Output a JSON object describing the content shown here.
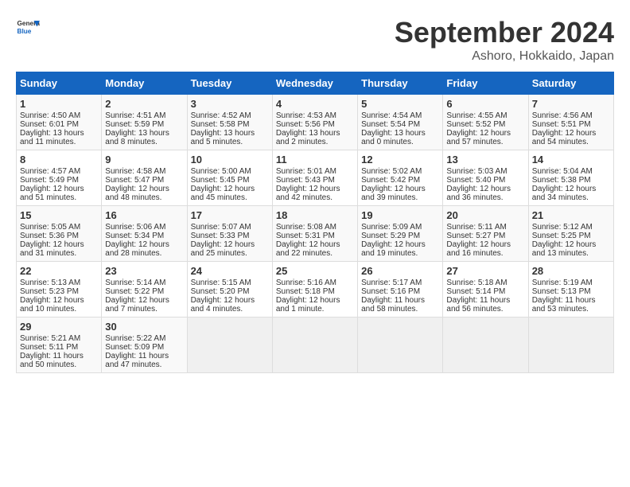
{
  "header": {
    "logo_line1": "General",
    "logo_line2": "Blue",
    "month": "September 2024",
    "location": "Ashoro, Hokkaido, Japan"
  },
  "days_of_week": [
    "Sunday",
    "Monday",
    "Tuesday",
    "Wednesday",
    "Thursday",
    "Friday",
    "Saturday"
  ],
  "weeks": [
    [
      {
        "day": "1",
        "info": [
          "Sunrise: 4:50 AM",
          "Sunset: 6:01 PM",
          "Daylight: 13 hours",
          "and 11 minutes."
        ]
      },
      {
        "day": "2",
        "info": [
          "Sunrise: 4:51 AM",
          "Sunset: 5:59 PM",
          "Daylight: 13 hours",
          "and 8 minutes."
        ]
      },
      {
        "day": "3",
        "info": [
          "Sunrise: 4:52 AM",
          "Sunset: 5:58 PM",
          "Daylight: 13 hours",
          "and 5 minutes."
        ]
      },
      {
        "day": "4",
        "info": [
          "Sunrise: 4:53 AM",
          "Sunset: 5:56 PM",
          "Daylight: 13 hours",
          "and 2 minutes."
        ]
      },
      {
        "day": "5",
        "info": [
          "Sunrise: 4:54 AM",
          "Sunset: 5:54 PM",
          "Daylight: 13 hours",
          "and 0 minutes."
        ]
      },
      {
        "day": "6",
        "info": [
          "Sunrise: 4:55 AM",
          "Sunset: 5:52 PM",
          "Daylight: 12 hours",
          "and 57 minutes."
        ]
      },
      {
        "day": "7",
        "info": [
          "Sunrise: 4:56 AM",
          "Sunset: 5:51 PM",
          "Daylight: 12 hours",
          "and 54 minutes."
        ]
      }
    ],
    [
      {
        "day": "8",
        "info": [
          "Sunrise: 4:57 AM",
          "Sunset: 5:49 PM",
          "Daylight: 12 hours",
          "and 51 minutes."
        ]
      },
      {
        "day": "9",
        "info": [
          "Sunrise: 4:58 AM",
          "Sunset: 5:47 PM",
          "Daylight: 12 hours",
          "and 48 minutes."
        ]
      },
      {
        "day": "10",
        "info": [
          "Sunrise: 5:00 AM",
          "Sunset: 5:45 PM",
          "Daylight: 12 hours",
          "and 45 minutes."
        ]
      },
      {
        "day": "11",
        "info": [
          "Sunrise: 5:01 AM",
          "Sunset: 5:43 PM",
          "Daylight: 12 hours",
          "and 42 minutes."
        ]
      },
      {
        "day": "12",
        "info": [
          "Sunrise: 5:02 AM",
          "Sunset: 5:42 PM",
          "Daylight: 12 hours",
          "and 39 minutes."
        ]
      },
      {
        "day": "13",
        "info": [
          "Sunrise: 5:03 AM",
          "Sunset: 5:40 PM",
          "Daylight: 12 hours",
          "and 36 minutes."
        ]
      },
      {
        "day": "14",
        "info": [
          "Sunrise: 5:04 AM",
          "Sunset: 5:38 PM",
          "Daylight: 12 hours",
          "and 34 minutes."
        ]
      }
    ],
    [
      {
        "day": "15",
        "info": [
          "Sunrise: 5:05 AM",
          "Sunset: 5:36 PM",
          "Daylight: 12 hours",
          "and 31 minutes."
        ]
      },
      {
        "day": "16",
        "info": [
          "Sunrise: 5:06 AM",
          "Sunset: 5:34 PM",
          "Daylight: 12 hours",
          "and 28 minutes."
        ]
      },
      {
        "day": "17",
        "info": [
          "Sunrise: 5:07 AM",
          "Sunset: 5:33 PM",
          "Daylight: 12 hours",
          "and 25 minutes."
        ]
      },
      {
        "day": "18",
        "info": [
          "Sunrise: 5:08 AM",
          "Sunset: 5:31 PM",
          "Daylight: 12 hours",
          "and 22 minutes."
        ]
      },
      {
        "day": "19",
        "info": [
          "Sunrise: 5:09 AM",
          "Sunset: 5:29 PM",
          "Daylight: 12 hours",
          "and 19 minutes."
        ]
      },
      {
        "day": "20",
        "info": [
          "Sunrise: 5:11 AM",
          "Sunset: 5:27 PM",
          "Daylight: 12 hours",
          "and 16 minutes."
        ]
      },
      {
        "day": "21",
        "info": [
          "Sunrise: 5:12 AM",
          "Sunset: 5:25 PM",
          "Daylight: 12 hours",
          "and 13 minutes."
        ]
      }
    ],
    [
      {
        "day": "22",
        "info": [
          "Sunrise: 5:13 AM",
          "Sunset: 5:23 PM",
          "Daylight: 12 hours",
          "and 10 minutes."
        ]
      },
      {
        "day": "23",
        "info": [
          "Sunrise: 5:14 AM",
          "Sunset: 5:22 PM",
          "Daylight: 12 hours",
          "and 7 minutes."
        ]
      },
      {
        "day": "24",
        "info": [
          "Sunrise: 5:15 AM",
          "Sunset: 5:20 PM",
          "Daylight: 12 hours",
          "and 4 minutes."
        ]
      },
      {
        "day": "25",
        "info": [
          "Sunrise: 5:16 AM",
          "Sunset: 5:18 PM",
          "Daylight: 12 hours",
          "and 1 minute."
        ]
      },
      {
        "day": "26",
        "info": [
          "Sunrise: 5:17 AM",
          "Sunset: 5:16 PM",
          "Daylight: 11 hours",
          "and 58 minutes."
        ]
      },
      {
        "day": "27",
        "info": [
          "Sunrise: 5:18 AM",
          "Sunset: 5:14 PM",
          "Daylight: 11 hours",
          "and 56 minutes."
        ]
      },
      {
        "day": "28",
        "info": [
          "Sunrise: 5:19 AM",
          "Sunset: 5:13 PM",
          "Daylight: 11 hours",
          "and 53 minutes."
        ]
      }
    ],
    [
      {
        "day": "29",
        "info": [
          "Sunrise: 5:21 AM",
          "Sunset: 5:11 PM",
          "Daylight: 11 hours",
          "and 50 minutes."
        ]
      },
      {
        "day": "30",
        "info": [
          "Sunrise: 5:22 AM",
          "Sunset: 5:09 PM",
          "Daylight: 11 hours",
          "and 47 minutes."
        ]
      },
      {
        "day": "",
        "info": []
      },
      {
        "day": "",
        "info": []
      },
      {
        "day": "",
        "info": []
      },
      {
        "day": "",
        "info": []
      },
      {
        "day": "",
        "info": []
      }
    ]
  ]
}
